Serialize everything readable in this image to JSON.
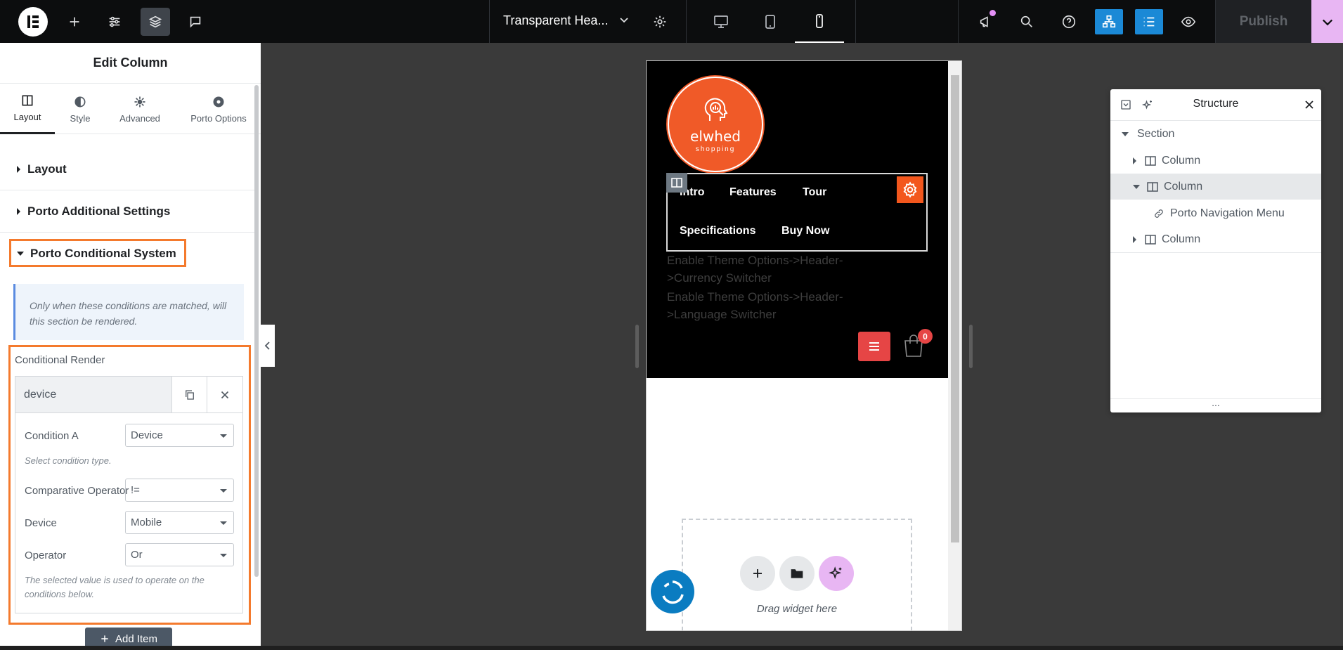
{
  "topbar": {
    "document_title": "Transparent Hea...",
    "publish_label": "Publish",
    "icons": [
      "elementor-logo-icon",
      "plus-icon",
      "sliders-icon",
      "layers-icon",
      "comment-icon",
      "chevron-down-icon",
      "gear-icon",
      "desktop-icon",
      "tablet-icon",
      "mobile-icon",
      "megaphone-icon",
      "search-icon",
      "help-icon",
      "structure-icon",
      "list-icon",
      "eye-icon"
    ],
    "colors": {
      "bar": "#0c0d0e",
      "blue": "#1b89d6",
      "publish_arrow": "#e8b6f3"
    }
  },
  "panel": {
    "title": "Edit Column",
    "tabs": [
      {
        "label": "Layout"
      },
      {
        "label": "Style"
      },
      {
        "label": "Advanced"
      },
      {
        "label": "Porto Options"
      }
    ],
    "sections": [
      {
        "label": "Layout"
      },
      {
        "label": "Porto Additional Settings"
      },
      {
        "label": "Porto Conditional System"
      }
    ],
    "info": "Only when these conditions are matched, will this section be rendered.",
    "conditional_render": {
      "label": "Conditional Render",
      "item_title": "device",
      "condition_a_label": "Condition A",
      "condition_a_value": "Device",
      "condition_a_hint": "Select condition type.",
      "comparative_label": "Comparative Operator",
      "comparative_value": "!=",
      "device_label": "Device",
      "device_value": "Mobile",
      "operator_label": "Operator",
      "operator_value": "Or",
      "operator_hint": "The selected value is used to operate on the conditions below."
    },
    "add_item_label": "Add Item",
    "highlight_color": "#f47a2d"
  },
  "preview": {
    "brand_name": "elwhed",
    "brand_sub": "shopping",
    "nav": [
      "Intro",
      "Features",
      "Tour",
      "Specifications",
      "Buy Now"
    ],
    "currency_notice": [
      "Enable Theme Options->Header-",
      ">Currency Switcher"
    ],
    "language_notice": [
      "Enable Theme Options->Header-",
      ">Language Switcher"
    ],
    "cart_count": "0",
    "drop_text": "Drag widget here",
    "colors": {
      "brand": "#f05a28",
      "menu": "#e64545"
    }
  },
  "structure": {
    "title": "Structure",
    "rows": [
      {
        "label": "Section"
      },
      {
        "label": "Column"
      },
      {
        "label": "Column"
      },
      {
        "label": "Porto Navigation Menu"
      },
      {
        "label": "Column"
      }
    ],
    "footer": "..."
  }
}
